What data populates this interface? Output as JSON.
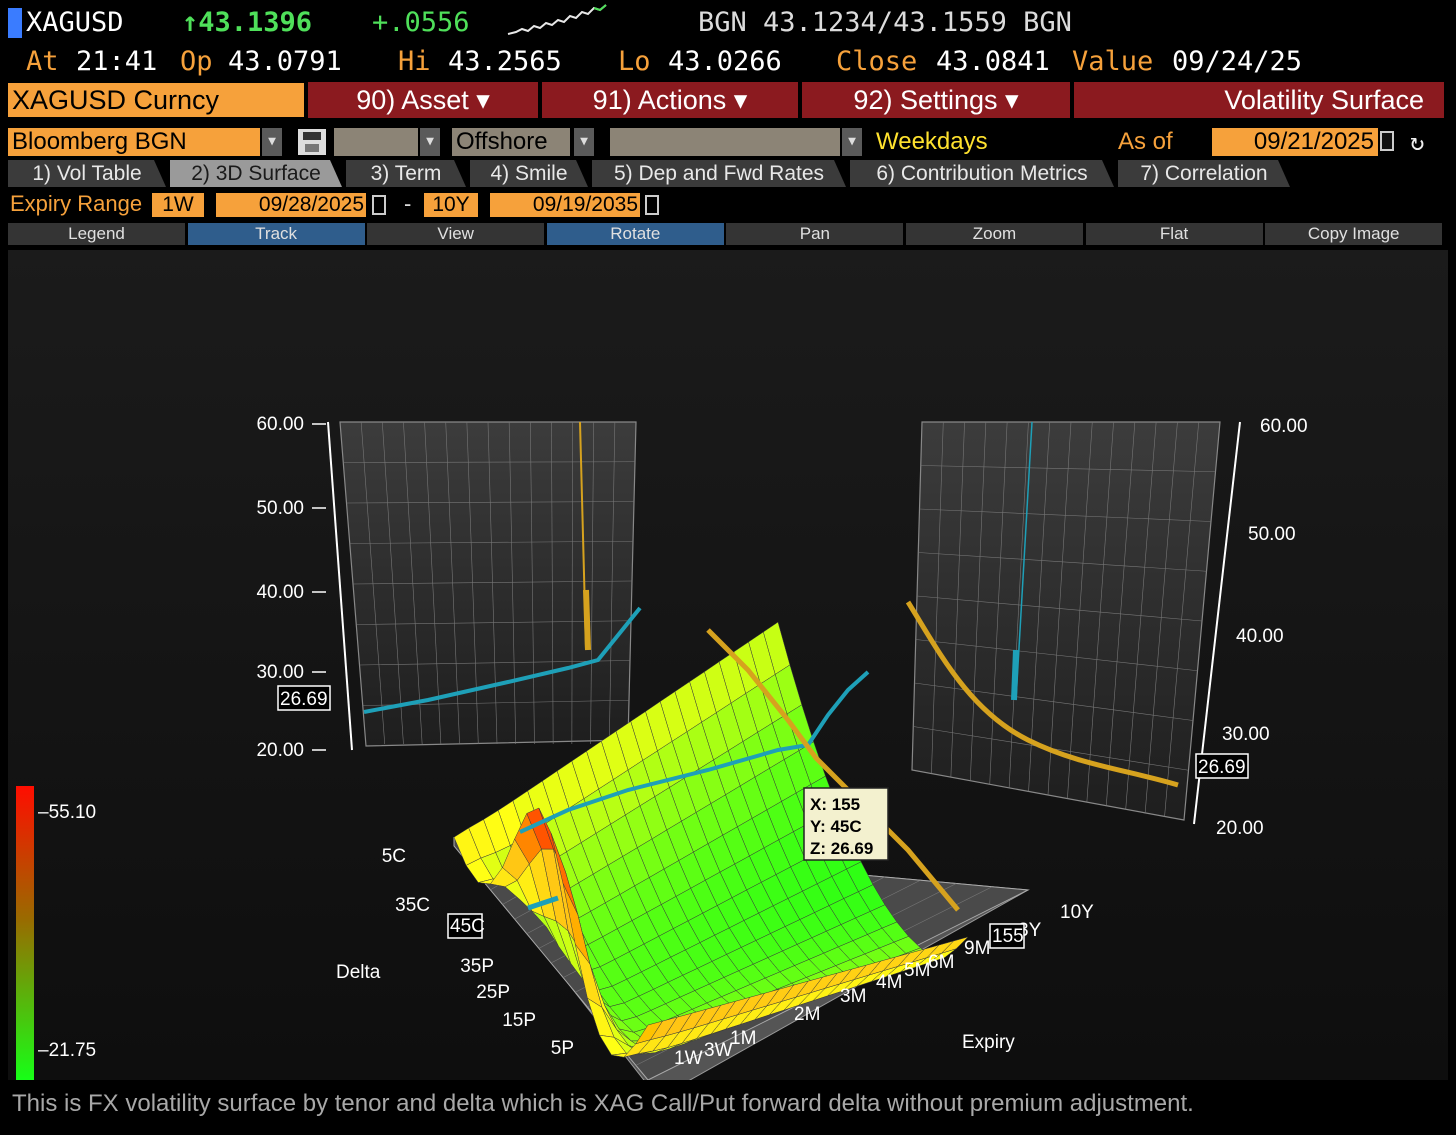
{
  "header": {
    "ticker": "XAGUSD",
    "last_price": "↑43.1396",
    "change": "+.0556",
    "bid_ask": "BGN 43.1234/43.1559 BGN",
    "time_label": "At",
    "time": "21:41",
    "open_label": "Op",
    "open": "43.0791",
    "high_label": "Hi",
    "high": "43.2565",
    "low_label": "Lo",
    "low": "43.0266",
    "close_label": "Close",
    "close": "43.0841",
    "value_label": "Value",
    "value_date": "09/24/25"
  },
  "menu": {
    "security": "XAGUSD Curncy",
    "asset": "90) Asset ▾",
    "actions": "91) Actions ▾",
    "settings": "92) Settings ▾",
    "title": "Volatility Surface"
  },
  "selectors": {
    "source": "Bloomberg BGN",
    "market": "Offshore",
    "days": "Weekdays",
    "as_of_label": "As of",
    "as_of_date": "09/21/2025"
  },
  "tabs": [
    {
      "label": "1) Vol Table",
      "active": false
    },
    {
      "label": "2) 3D Surface",
      "active": true
    },
    {
      "label": "3) Term",
      "active": false
    },
    {
      "label": "4) Smile",
      "active": false
    },
    {
      "label": "5) Dep and Fwd Rates",
      "active": false
    },
    {
      "label": "6) Contribution Metrics",
      "active": false
    },
    {
      "label": "7) Correlation",
      "active": false
    }
  ],
  "expiry_range": {
    "label": "Expiry Range",
    "from_tenor": "1W",
    "from_date": "09/28/2025",
    "separator": "-",
    "to_tenor": "10Y",
    "to_date": "09/19/2035"
  },
  "toolbar": [
    "Legend",
    "Track",
    "View",
    "Rotate",
    "Pan",
    "Zoom",
    "Flat",
    "Copy Image"
  ],
  "toolbar_active": [
    "Track",
    "Rotate"
  ],
  "chart_data": {
    "type": "surface",
    "xlabel": "Expiry",
    "ylabel": "Delta",
    "expiry_ticks": [
      "1W",
      "3W",
      "1M",
      "2M",
      "3M",
      "4M",
      "5M",
      "6M",
      "9M",
      "3Y",
      "10Y"
    ],
    "delta_ticks": [
      "5C",
      "35C",
      "45C",
      "35P",
      "25P",
      "15P",
      "5P"
    ],
    "z_ticks": [
      "20.00",
      "30.00",
      "40.00",
      "50.00",
      "60.00"
    ],
    "zlim": [
      20,
      60
    ],
    "color_scale": {
      "max": "55.10",
      "min": "21.75",
      "max_color": "#ff1a00",
      "min_color": "#16ff16"
    },
    "tracked_value": {
      "z": "26.69",
      "x": "155",
      "y": "45C"
    },
    "tooltip": [
      "X: 155",
      "Y: 45C",
      "Z: 26.69"
    ],
    "colors": {
      "low": "#33ff22",
      "mid": "#ffff1f",
      "high": "#ff2a00",
      "track": "#1ea0b8",
      "term": "#d6a21e"
    }
  },
  "footer": "This is FX volatility surface by tenor and delta which is XAG Call/Put forward delta without premium adjustment."
}
